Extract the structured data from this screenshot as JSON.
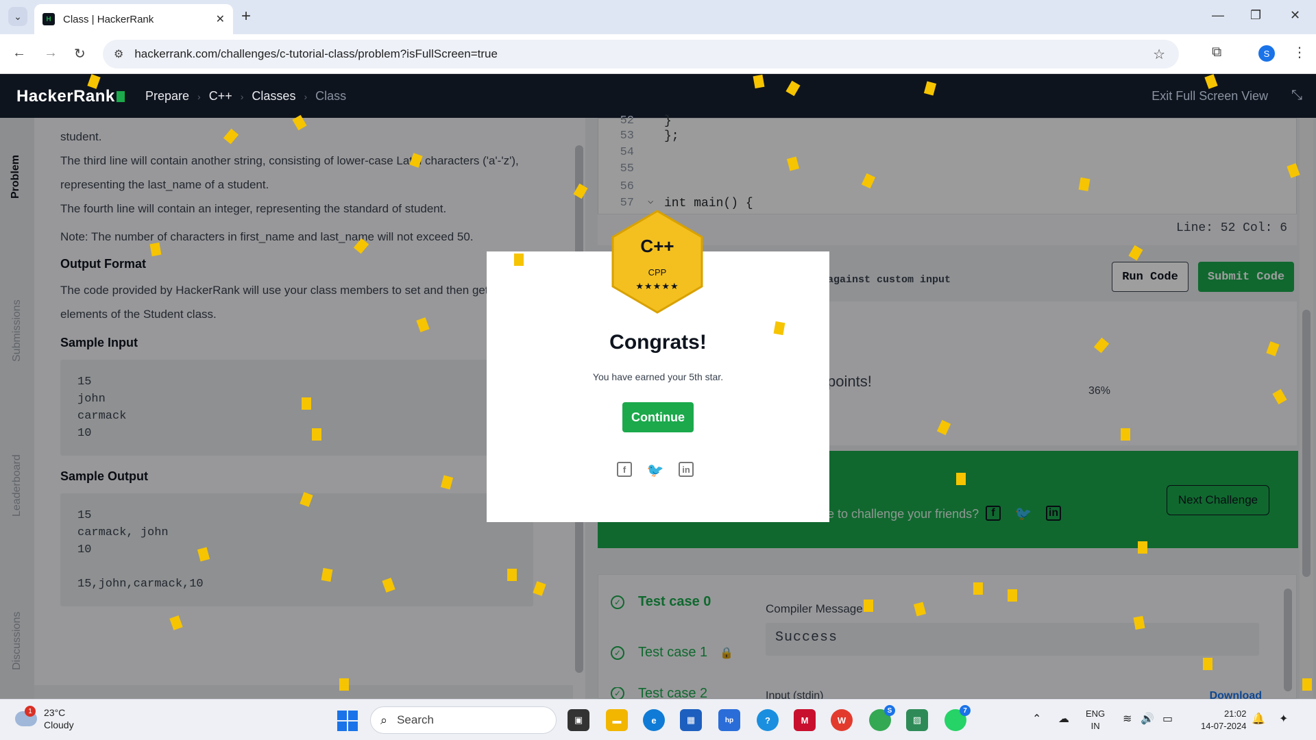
{
  "browser": {
    "tab_title": "Class | HackerRank",
    "url": "hackerrank.com/challenges/c-tutorial-class/problem?isFullScreen=true",
    "profile_initial": "S"
  },
  "header": {
    "logo": "HackerRank",
    "breadcrumbs": [
      "Prepare",
      "C++",
      "Classes",
      "Class"
    ],
    "exit_fullscreen": "Exit Full Screen View"
  },
  "rail": {
    "tabs": [
      "Problem",
      "Submissions",
      "Leaderboard",
      "Discussions"
    ]
  },
  "problem": {
    "line0": "student.",
    "line1": "The third line will contain another string, consisting of lower-case Latin characters ('a'-'z'),",
    "line2": "representing the last_name of a student.",
    "line3": "The fourth line will contain an integer, representing the standard of student.",
    "note": "Note: The number of characters in first_name and last_name will not exceed 50.",
    "output_format_heading": "Output Format",
    "output_format_text1": "The code provided by HackerRank will use your class members to set and then get the",
    "output_format_text2": "elements of the Student class.",
    "sample_input_heading": "Sample Input",
    "sample_input": [
      "15",
      "john",
      "carmack",
      "10"
    ],
    "sample_output_heading": "Sample Output",
    "sample_output": [
      "15",
      "carmack, john",
      "10",
      "",
      "15,john,carmack,10"
    ]
  },
  "editor": {
    "lines": [
      {
        "n": "52",
        "code": "}"
      },
      {
        "n": "53",
        "code": "};"
      },
      {
        "n": "54",
        "code": ""
      },
      {
        "n": "55",
        "code": ""
      },
      {
        "n": "56",
        "code": ""
      },
      {
        "n": "57",
        "code": "int main() {"
      }
    ],
    "status": "Line: 52 Col: 6",
    "custom_input": "against custom input",
    "run_label": "Run Code",
    "submit_label": "Submit Code"
  },
  "result": {
    "points_text": "points!",
    "percent": "36%",
    "challenge_text": "e to challenge your friends?",
    "next_label": "Next Challenge"
  },
  "tests": {
    "case0": "Test case 0",
    "case1": "Test case 1",
    "case2": "Test case 2",
    "compiler_label": "Compiler Message",
    "compiler_value": "Success",
    "stdin_label": "Input (stdin)",
    "download_label": "Download"
  },
  "modal": {
    "badge_name": "C++",
    "badge_type": "CPP",
    "badge_stars": "★★★★★",
    "title": "Congrats!",
    "message": "You have earned your 5th star.",
    "continue_label": "Continue"
  },
  "taskbar": {
    "temperature": "23°C",
    "condition": "Cloudy",
    "weather_badge": "1",
    "search_placeholder": "Search",
    "lang1": "ENG",
    "lang2": "IN",
    "time": "21:02",
    "date": "14-07-2024",
    "chrome_badge": "S",
    "whatsapp_badge": "7"
  },
  "colors": {
    "brand_green": "#1ba94c",
    "header_dark": "#0e141e",
    "confetti": "#f6c400"
  }
}
